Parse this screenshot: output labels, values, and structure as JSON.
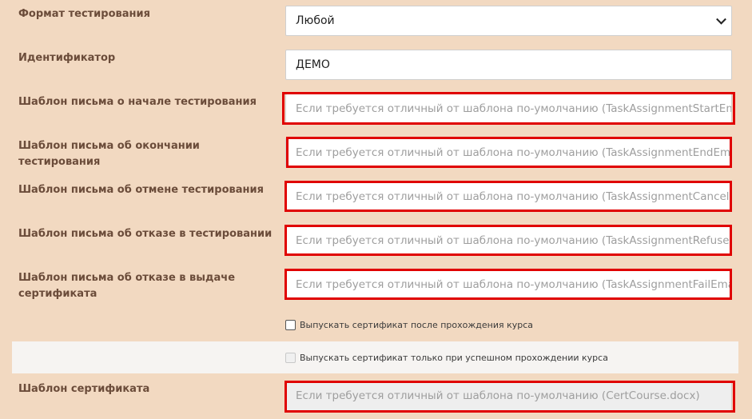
{
  "form": {
    "format": {
      "label": "Формат тестирования",
      "value": "Любой"
    },
    "identifier": {
      "label": "Идентификатор",
      "value": "ДЕМО"
    },
    "start_email": {
      "label": "Шаблон письма о начале тестирования",
      "placeholder": "Если требуется отличный от шаблона по-умолчанию (TaskAssignmentStartEmail.h"
    },
    "end_email": {
      "label": "Шаблон письма об окончании тестирования",
      "placeholder": "Если требуется отличный от шаблона по-умолчанию (TaskAssignmentEndEmail.h"
    },
    "cancel_email": {
      "label": "Шаблон письма об отмене тестирования",
      "placeholder": "Если требуется отличный от шаблона по-умолчанию (TaskAssignmentCancelEmai"
    },
    "refuse_email": {
      "label": "Шаблон письма об отказе в тестировании",
      "placeholder": "Если требуется отличный от шаблона по-умолчанию (TaskAssignmentRefuseEma"
    },
    "fail_email": {
      "label": "Шаблон письма об отказе в выдаче сертификата",
      "placeholder": "Если требуется отличный от шаблона по-умолчанию (TaskAssignmentFailEmail.ht"
    },
    "issue_cert": {
      "label": "Выпускать сертификат после прохождения курса"
    },
    "issue_cert_success": {
      "label": "Выпускать сертификат только при успешном прохождении курса"
    },
    "cert_template": {
      "label": "Шаблон сертификата",
      "placeholder": "Если требуется отличный от шаблона по-умолчанию (CertCourse.docx)"
    }
  },
  "colors": {
    "background": "#f2d9c1",
    "label": "#6b4c3a",
    "highlight": "#e00000"
  }
}
